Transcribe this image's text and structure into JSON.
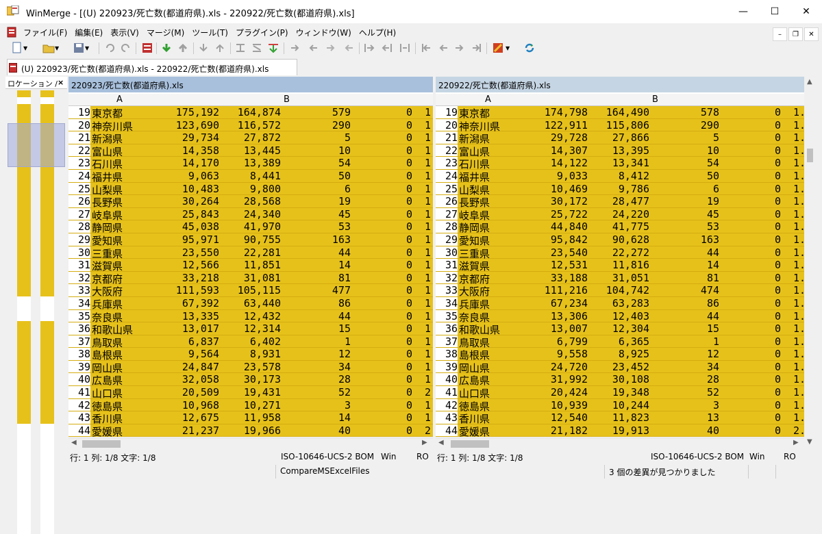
{
  "window": {
    "title": "WinMerge - [(U) 220923/死亡数(都道府県).xls - 220922/死亡数(都道府県).xls]",
    "minimize": "—",
    "maximize": "☐",
    "close": "✕"
  },
  "menu": {
    "items": [
      "ファイル(F)",
      "編集(E)",
      "表示(V)",
      "マージ(M)",
      "ツール(T)",
      "プラグイン(P)",
      "ウィンドウ(W)",
      "ヘルプ(H)"
    ],
    "mdi_min": "–",
    "mdi_restore": "❐",
    "mdi_close": "✕"
  },
  "tab": {
    "label": "(U) 220923/死亡数(都道府県).xls - 220922/死亡数(都道府県).xls"
  },
  "location_pane": {
    "title": "ロケーション /",
    "close": "×"
  },
  "left_pane": {
    "file": "220923/死亡数(都道府県).xls",
    "col_a": "A",
    "col_b": "B",
    "rows": [
      [
        "19",
        "東京都",
        "175,192",
        "164,874",
        "579",
        "0",
        "1."
      ],
      [
        "20",
        "神奈川県",
        "123,690",
        "116,572",
        "290",
        "0",
        "1."
      ],
      [
        "21",
        "新潟県",
        "29,734",
        "27,872",
        "5",
        "0",
        "1."
      ],
      [
        "22",
        "富山県",
        "14,358",
        "13,445",
        "10",
        "0",
        "1."
      ],
      [
        "23",
        "石川県",
        "14,170",
        "13,389",
        "54",
        "0",
        "1."
      ],
      [
        "24",
        "福井県",
        "9,063",
        "8,441",
        "50",
        "0",
        "1."
      ],
      [
        "25",
        "山梨県",
        "10,483",
        "9,800",
        "6",
        "0",
        "1."
      ],
      [
        "26",
        "長野県",
        "30,264",
        "28,568",
        "19",
        "0",
        "1."
      ],
      [
        "27",
        "岐阜県",
        "25,843",
        "24,340",
        "45",
        "0",
        "1."
      ],
      [
        "28",
        "静岡県",
        "45,038",
        "41,970",
        "53",
        "0",
        "1."
      ],
      [
        "29",
        "愛知県",
        "95,971",
        "90,755",
        "163",
        "0",
        "1."
      ],
      [
        "30",
        "三重県",
        "23,550",
        "22,281",
        "44",
        "0",
        "1."
      ],
      [
        "31",
        "滋賀県",
        "12,566",
        "11,851",
        "14",
        "0",
        "1."
      ],
      [
        "32",
        "京都府",
        "33,218",
        "31,081",
        "81",
        "0",
        "1."
      ],
      [
        "33",
        "大阪府",
        "111,593",
        "105,115",
        "477",
        "0",
        "1."
      ],
      [
        "34",
        "兵庫県",
        "67,392",
        "63,440",
        "86",
        "0",
        "1."
      ],
      [
        "35",
        "奈良県",
        "13,335",
        "12,432",
        "44",
        "0",
        "1."
      ],
      [
        "36",
        "和歌山県",
        "13,017",
        "12,314",
        "15",
        "0",
        "1."
      ],
      [
        "37",
        "鳥取県",
        "6,837",
        "6,402",
        "1",
        "0",
        "1."
      ],
      [
        "38",
        "島根県",
        "9,564",
        "8,931",
        "12",
        "0",
        "1."
      ],
      [
        "39",
        "岡山県",
        "24,847",
        "23,578",
        "34",
        "0",
        "1."
      ],
      [
        "40",
        "広島県",
        "32,058",
        "30,173",
        "28",
        "0",
        "1."
      ],
      [
        "41",
        "山口県",
        "20,509",
        "19,431",
        "52",
        "0",
        "2."
      ],
      [
        "42",
        "徳島県",
        "10,968",
        "10,271",
        "3",
        "0",
        "1."
      ],
      [
        "43",
        "香川県",
        "12,675",
        "11,958",
        "14",
        "0",
        "1."
      ],
      [
        "44",
        "愛媛県",
        "21,237",
        "19,966",
        "40",
        "0",
        "2."
      ]
    ],
    "status": {
      "pos": "行: 1  列: 1/8  文字: 1/8",
      "enc": "ISO-10646-UCS-2 BOM",
      "eol": "Win",
      "ro": "RO"
    }
  },
  "right_pane": {
    "file": "220922/死亡数(都道府県).xls",
    "col_a": "A",
    "col_b": "B",
    "rows": [
      [
        "19",
        "東京都",
        "174,798",
        "164,490",
        "578",
        "0",
        "1."
      ],
      [
        "20",
        "神奈川県",
        "122,911",
        "115,806",
        "290",
        "0",
        "1."
      ],
      [
        "21",
        "新潟県",
        "29,728",
        "27,866",
        "5",
        "0",
        "1."
      ],
      [
        "22",
        "富山県",
        "14,307",
        "13,395",
        "10",
        "0",
        "1."
      ],
      [
        "23",
        "石川県",
        "14,122",
        "13,341",
        "54",
        "0",
        "1."
      ],
      [
        "24",
        "福井県",
        "9,033",
        "8,412",
        "50",
        "0",
        "1."
      ],
      [
        "25",
        "山梨県",
        "10,469",
        "9,786",
        "6",
        "0",
        "1."
      ],
      [
        "26",
        "長野県",
        "30,172",
        "28,477",
        "19",
        "0",
        "1."
      ],
      [
        "27",
        "岐阜県",
        "25,722",
        "24,220",
        "45",
        "0",
        "1."
      ],
      [
        "28",
        "静岡県",
        "44,840",
        "41,775",
        "53",
        "0",
        "1."
      ],
      [
        "29",
        "愛知県",
        "95,842",
        "90,628",
        "163",
        "0",
        "1."
      ],
      [
        "30",
        "三重県",
        "23,540",
        "22,272",
        "44",
        "0",
        "1."
      ],
      [
        "31",
        "滋賀県",
        "12,531",
        "11,816",
        "14",
        "0",
        "1."
      ],
      [
        "32",
        "京都府",
        "33,188",
        "31,051",
        "81",
        "0",
        "1."
      ],
      [
        "33",
        "大阪府",
        "111,216",
        "104,742",
        "474",
        "0",
        "1."
      ],
      [
        "34",
        "兵庫県",
        "67,234",
        "63,283",
        "86",
        "0",
        "1."
      ],
      [
        "35",
        "奈良県",
        "13,306",
        "12,403",
        "44",
        "0",
        "1."
      ],
      [
        "36",
        "和歌山県",
        "13,007",
        "12,304",
        "15",
        "0",
        "1."
      ],
      [
        "37",
        "鳥取県",
        "6,799",
        "6,365",
        "1",
        "0",
        "1."
      ],
      [
        "38",
        "島根県",
        "9,558",
        "8,925",
        "12",
        "0",
        "1."
      ],
      [
        "39",
        "岡山県",
        "24,720",
        "23,452",
        "34",
        "0",
        "1."
      ],
      [
        "40",
        "広島県",
        "31,992",
        "30,108",
        "28",
        "0",
        "1."
      ],
      [
        "41",
        "山口県",
        "20,424",
        "19,348",
        "52",
        "0",
        "1."
      ],
      [
        "42",
        "徳島県",
        "10,939",
        "10,244",
        "3",
        "0",
        "1."
      ],
      [
        "43",
        "香川県",
        "12,540",
        "11,823",
        "13",
        "0",
        "1."
      ],
      [
        "44",
        "愛媛県",
        "21,182",
        "19,913",
        "40",
        "0",
        "2."
      ]
    ],
    "status": {
      "pos": "行: 1  列: 1/8  文字: 1/8",
      "enc": "ISO-10646-UCS-2 BOM",
      "eol": "Win",
      "ro": "RO"
    }
  },
  "statusbar": {
    "plugin": "CompareMSExcelFiles",
    "diffs": "3 個の差異が見つかりました"
  },
  "colors": {
    "diff_bg": "#e6c11a",
    "diff_word": "#f6e0a0",
    "file_header_left": "#a8c0dc",
    "file_header_right": "#c5d5e3"
  }
}
